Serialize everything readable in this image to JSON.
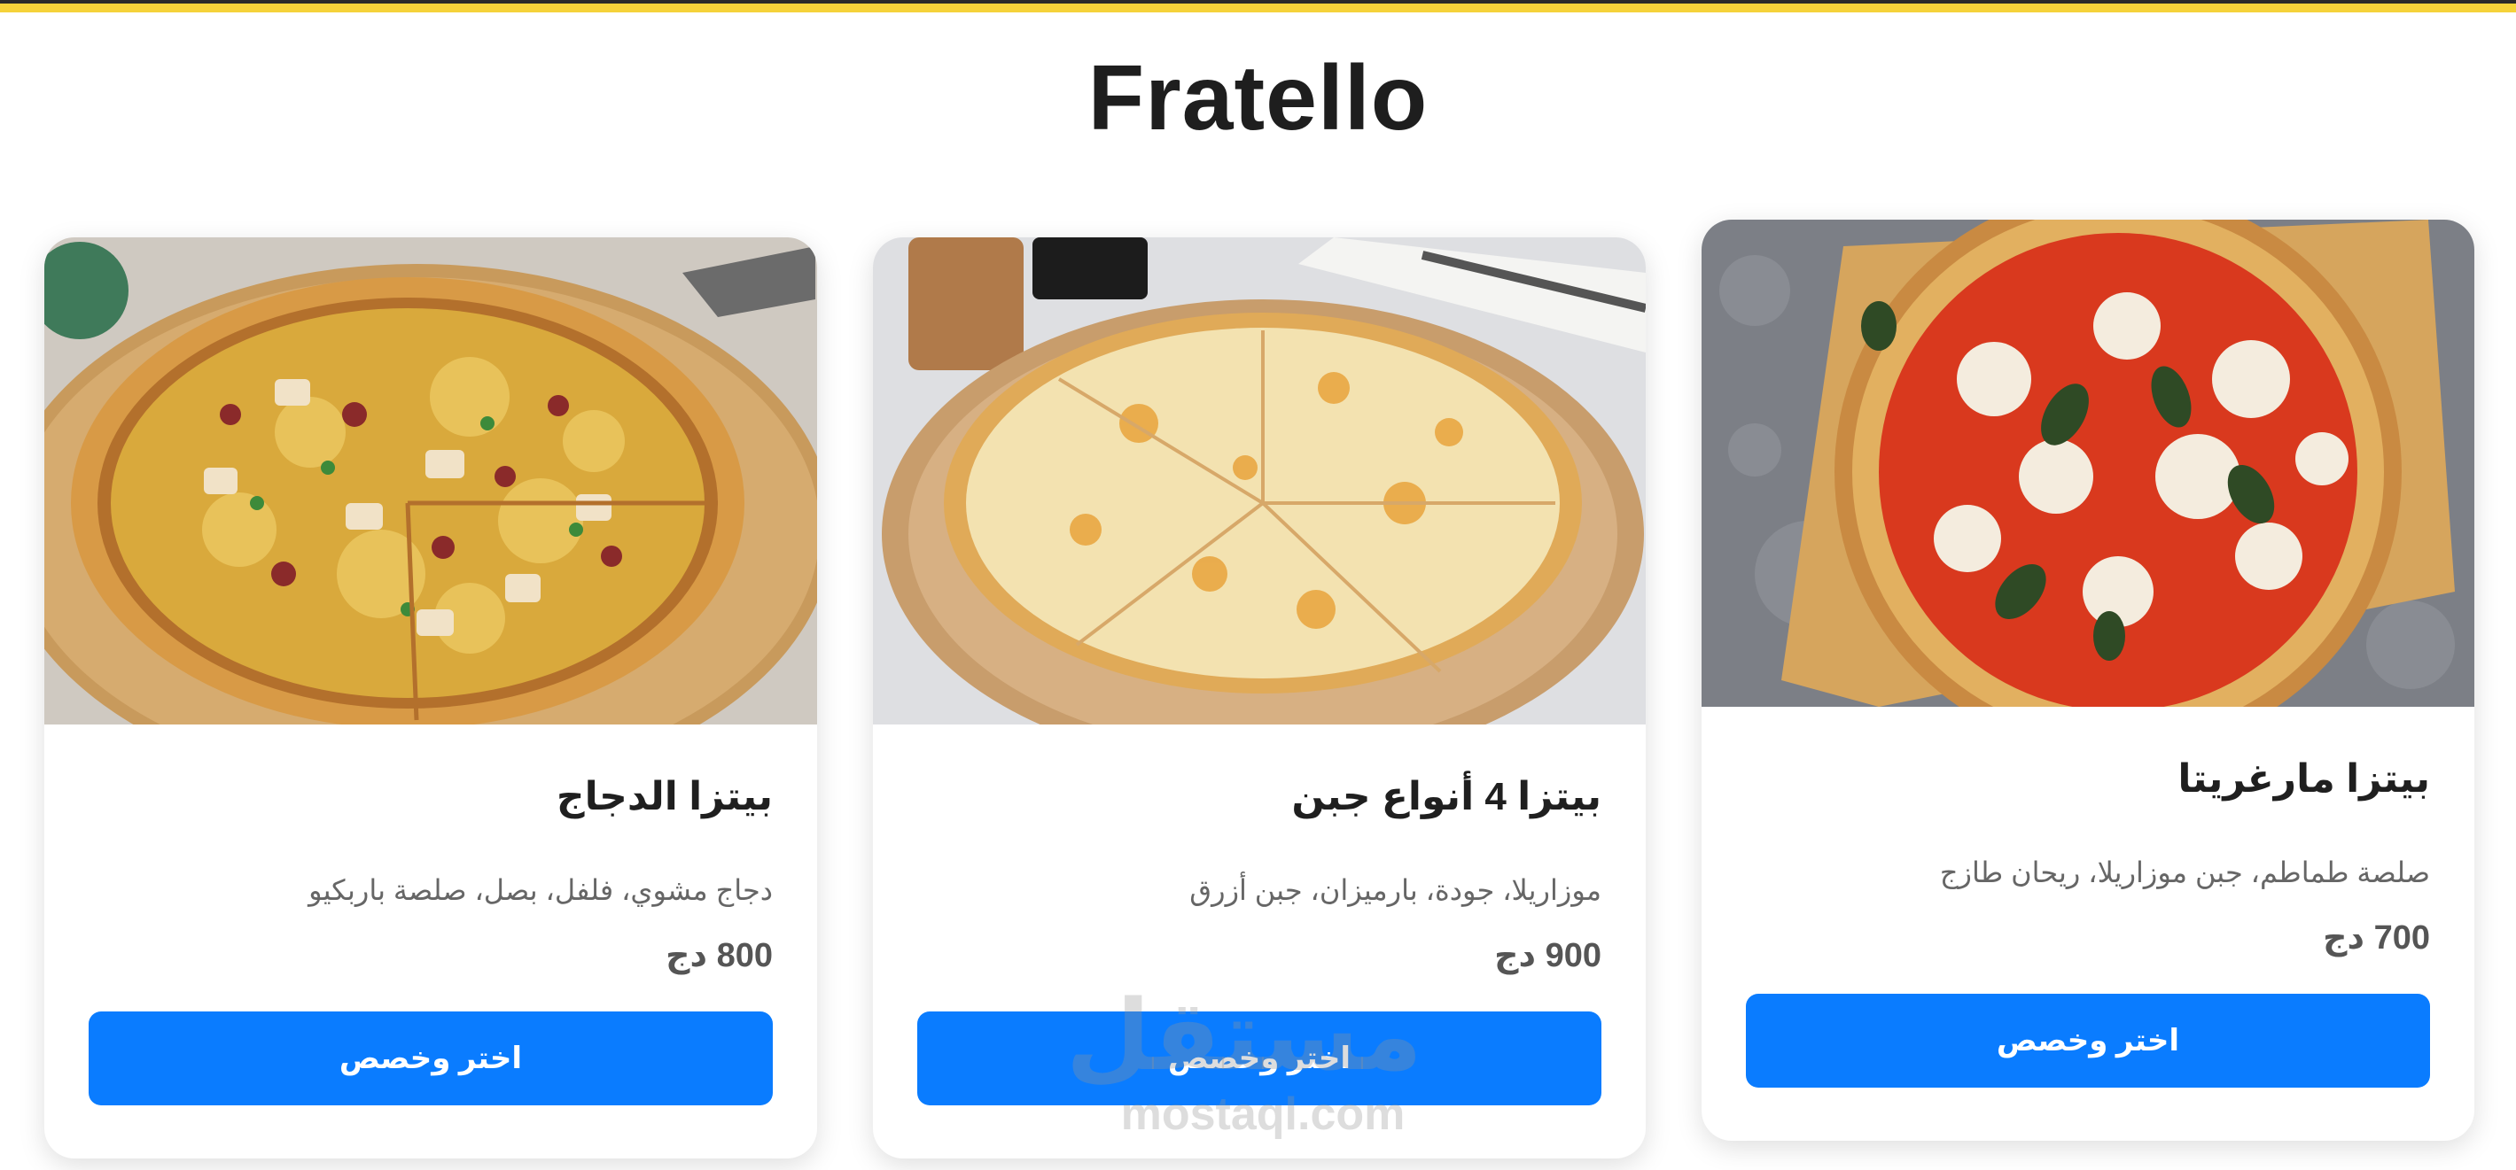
{
  "site": {
    "title": "Fratello"
  },
  "colors": {
    "top_border": "#f5d23a",
    "button": "#0a7cff"
  },
  "menu": [
    {
      "name": "بيتزا الدجاج",
      "description": "دجاج مشوي، فلفل، بصل، صلصة باربكيو",
      "price": "800 دج",
      "button_label": "اختر وخصص",
      "image": "bbq-chicken-pizza"
    },
    {
      "name": "بيتزا 4 أنواع جبن",
      "description": "موزاريلا، جودة، بارميزان، جبن أزرق",
      "price": "900 دج",
      "button_label": "اختر وخصص",
      "image": "four-cheese-pizza"
    },
    {
      "name": "بيتزا مارغريتا",
      "description": "صلصة طماطم، جبن موزاريلا، ريحان طازج",
      "price": "700 دج",
      "button_label": "اختر وخصص",
      "image": "margherita-pizza"
    }
  ],
  "watermark": {
    "arabic": "مستقل",
    "latin": "mostaql.com"
  }
}
